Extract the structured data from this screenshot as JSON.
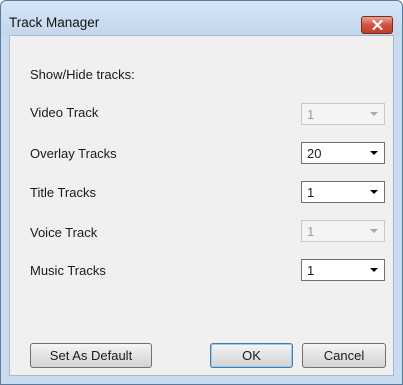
{
  "window": {
    "title": "Track Manager"
  },
  "header": {
    "text": "Show/Hide tracks:"
  },
  "tracks": [
    {
      "label": "Video Track",
      "value": "1",
      "enabled": false
    },
    {
      "label": "Overlay Tracks",
      "value": "20",
      "enabled": true
    },
    {
      "label": "Title Tracks",
      "value": "1",
      "enabled": true
    },
    {
      "label": "Voice Track",
      "value": "1",
      "enabled": false
    },
    {
      "label": "Music Tracks",
      "value": "1",
      "enabled": true
    }
  ],
  "buttons": {
    "set_default": "Set As Default",
    "ok": "OK",
    "cancel": "Cancel"
  },
  "colors": {
    "title_bar": "#c9dcef",
    "close_button": "#c8482f",
    "client": "#f0f0f0"
  },
  "icons": {
    "close": "close-icon"
  }
}
